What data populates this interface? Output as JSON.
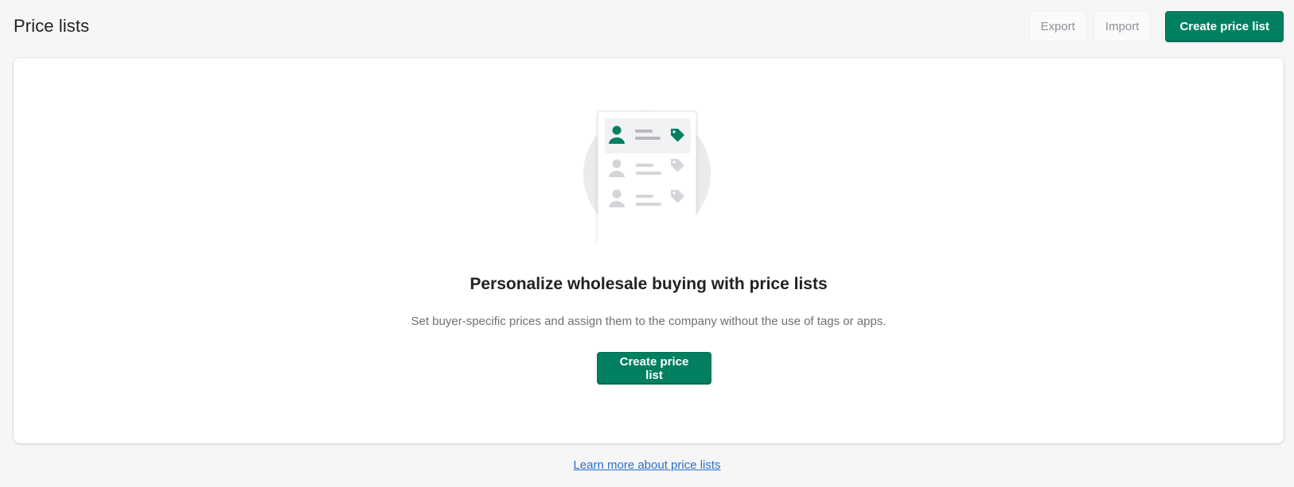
{
  "header": {
    "title": "Price lists",
    "export_label": "Export",
    "import_label": "Import",
    "create_label": "Create price list"
  },
  "empty_state": {
    "heading": "Personalize wholesale buying with price lists",
    "description": "Set buyer-specific prices and assign them to the company without the use of tags or apps.",
    "cta_label": "Create price list"
  },
  "footer": {
    "learn_more_label": "Learn more about price lists"
  },
  "colors": {
    "primary": "#008060",
    "background": "#f6f6f7",
    "link": "#2c6ecb"
  }
}
